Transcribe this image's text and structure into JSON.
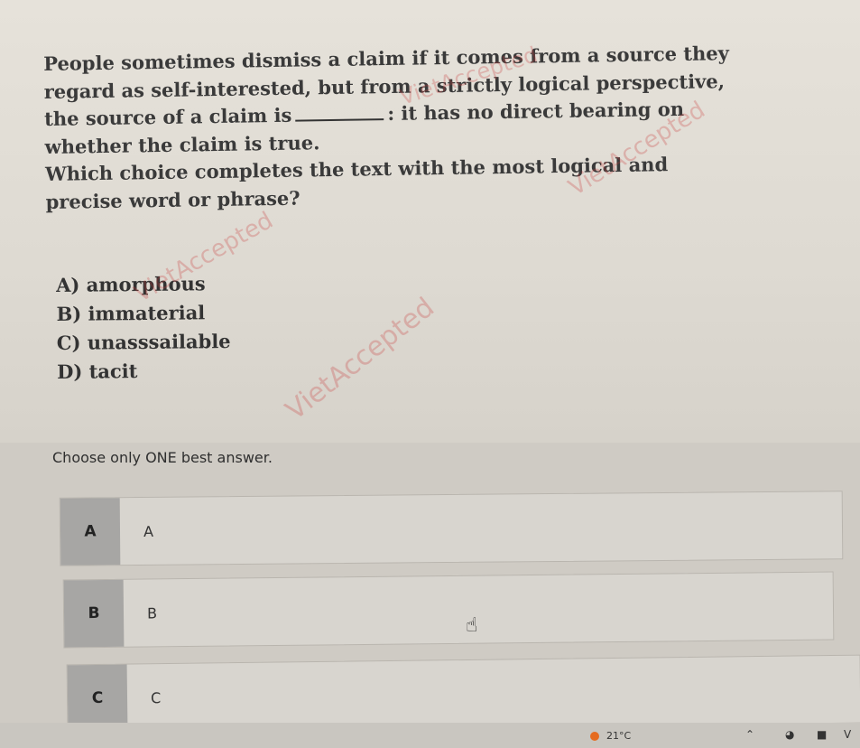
{
  "question": {
    "line1": "People sometimes dismiss a claim if it comes from a source they",
    "line2": "regard as self-interested, but from a strictly logical perspective,",
    "line3a": "the source of a claim is",
    "line3b": ": it has no direct bearing on",
    "line4": "whether the claim is true.",
    "prompt1": "Which choice completes the text with the most logical and",
    "prompt2": "precise word or phrase?"
  },
  "choices": [
    {
      "text": "A) amorphous"
    },
    {
      "text": "B) immaterial"
    },
    {
      "text": "C) unasssailable"
    },
    {
      "text": "D) tacit"
    }
  ],
  "watermark": "VietAccepted",
  "instruction": "Choose only ONE best answer.",
  "answer_options": [
    {
      "letter": "A",
      "label": "A"
    },
    {
      "letter": "B",
      "label": "B"
    },
    {
      "letter": "C",
      "label": "C"
    }
  ],
  "taskbar": {
    "temperature": "21°C",
    "weather_icon": "weather-alert-icon",
    "tray_icons": [
      "chevron-up-icon",
      "chrome-icon",
      "monitor-icon",
      "input-method-icon"
    ]
  }
}
